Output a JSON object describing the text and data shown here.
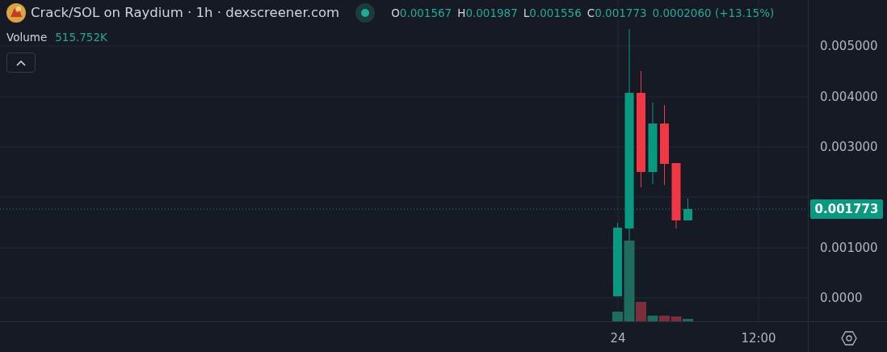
{
  "legend": {
    "title": "Crack/SOL on Raydium · 1h · dexscreener.com",
    "ohlc": [
      {
        "label": "O",
        "value": "0.001567"
      },
      {
        "label": "H",
        "value": "0.001987"
      },
      {
        "label": "L",
        "value": "0.001556"
      },
      {
        "label": "C",
        "value": "0.001773"
      }
    ],
    "change": "0.0002060 (+13.15%)",
    "volume_label": "Volume",
    "volume_value": "515.752K"
  },
  "price_axis": [
    "0.005000",
    "0.004000",
    "0.003000",
    "0.001000",
    "0.0000"
  ],
  "time_axis": [
    "24",
    "12:00"
  ],
  "price_tag": "0.001773"
}
